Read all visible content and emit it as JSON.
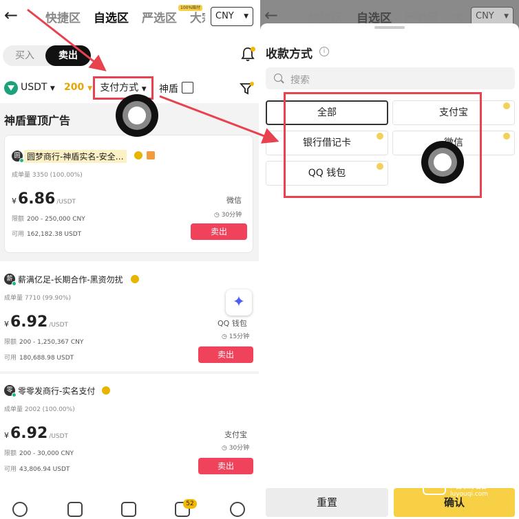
{
  "nav": {
    "tabs": [
      "快捷区",
      "自选区",
      "严选区",
      "大宗"
    ],
    "active": "自选区",
    "pill": "100%赔付",
    "currency": "CNY"
  },
  "left": {
    "buy": "买入",
    "sell": "卖出",
    "filters": {
      "coin": "USDT",
      "amount": "200",
      "payment": "支付方式",
      "shield": "神盾"
    },
    "section_title": "神盾置顶广告",
    "listings": [
      {
        "avatar": "圆",
        "name": "圆梦商行-神盾实名-安全…",
        "orders_key": "成单量",
        "orders": "3350 (100.00%)",
        "cur": "¥",
        "price": "6.86",
        "unit": "/USDT",
        "limit_key": "限额",
        "limit": "200 - 250,000 CNY",
        "avail_key": "可用",
        "avail": "162,182.38 USDT",
        "payment": "微信",
        "time": "30分钟",
        "action": "卖出"
      },
      {
        "avatar": "薪",
        "name": "薪满亿足-长期合作-黑资勿扰",
        "orders_key": "成单量",
        "orders": "7710 (99.90%)",
        "cur": "¥",
        "price": "6.92",
        "unit": "/USDT",
        "limit_key": "限额",
        "limit": "200 - 1,250,367 CNY",
        "avail_key": "可用",
        "avail": "180,688.98 USDT",
        "payment": "QQ 钱包",
        "time": "15分钟",
        "action": "卖出"
      },
      {
        "avatar": "零",
        "name": "零零发商行-实名支付",
        "orders_key": "成单量",
        "orders": "2002 (100.00%)",
        "cur": "¥",
        "price": "6.92",
        "unit": "/USDT",
        "limit_key": "限额",
        "limit": "200 - 30,000 CNY",
        "avail_key": "可用",
        "avail": "43,806.94 USDT",
        "payment": "支付宝",
        "time": "30分钟",
        "action": "卖出"
      }
    ],
    "bottom_badge": "52"
  },
  "right": {
    "title": "收款方式",
    "search_placeholder": "搜索",
    "options": [
      "全部",
      "支付宝",
      "银行借记卡",
      "微信",
      "QQ 钱包"
    ],
    "selected": "全部",
    "reset": "重置",
    "confirm": "确认"
  },
  "watermark": {
    "line1": "路由器",
    "line2": "luyouqi.com"
  },
  "colors": {
    "accent_yellow": "#f7d046",
    "sell_red": "#f0425a",
    "annotation_red": "#e8424f",
    "usdt_green": "#1aa37a"
  }
}
